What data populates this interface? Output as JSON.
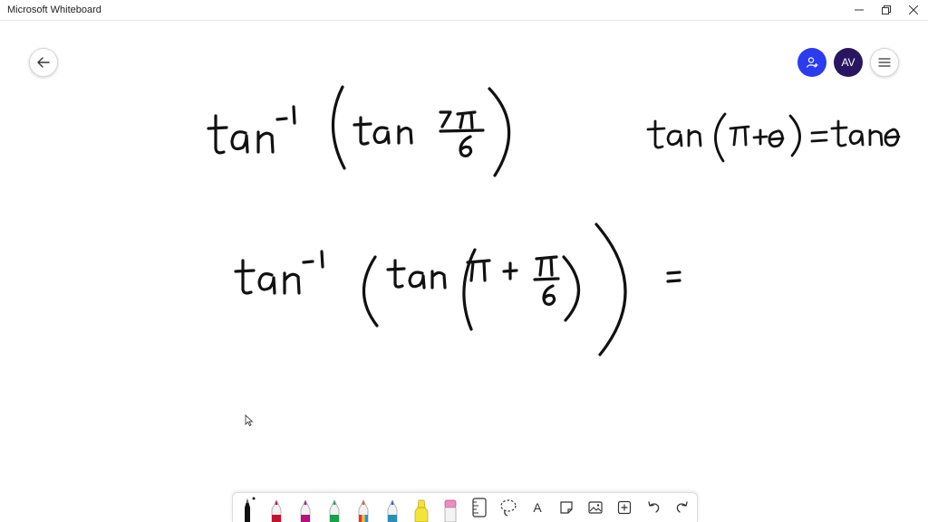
{
  "window": {
    "title": "Microsoft Whiteboard",
    "controls": [
      "minimize-icon",
      "restore-icon",
      "close-icon"
    ]
  },
  "header": {
    "back": {
      "icon": "arrow-left-icon"
    },
    "invite": {
      "icon": "person-add-icon",
      "color": "#2b3bf0"
    },
    "avatar": {
      "initials": "AV",
      "color": "#2a1660"
    },
    "menu": {
      "icon": "hamburger-icon"
    }
  },
  "canvas": {
    "expressions": [
      "tan⁻¹(tan 7π/6)",
      "tan(π+θ) = tanθ",
      "tan⁻¹(tan(π + π/6)) ="
    ]
  },
  "toolbar": {
    "tools": [
      {
        "name": "black-pen",
        "color": "#111111",
        "selected": true
      },
      {
        "name": "red-pen",
        "color": "#c8102e"
      },
      {
        "name": "magenta-pen",
        "color": "#b5117a"
      },
      {
        "name": "green-pen",
        "color": "#1e9e4a"
      },
      {
        "name": "rainbow-pen",
        "color": "#e0562a"
      },
      {
        "name": "galaxy-pen",
        "color": "#2a8fb5"
      },
      {
        "name": "highlighter",
        "color": "#f5e23a"
      },
      {
        "name": "eraser",
        "color": "#f08cc0"
      },
      {
        "name": "ruler",
        "icon": "ruler-icon"
      },
      {
        "name": "lasso",
        "icon": "lasso-icon"
      },
      {
        "name": "text",
        "label": "A"
      },
      {
        "name": "sticky-note",
        "icon": "note-icon"
      },
      {
        "name": "image",
        "icon": "image-icon"
      },
      {
        "name": "add",
        "icon": "plus-box-icon"
      },
      {
        "name": "undo",
        "icon": "undo-icon"
      },
      {
        "name": "redo",
        "icon": "redo-icon"
      }
    ]
  }
}
